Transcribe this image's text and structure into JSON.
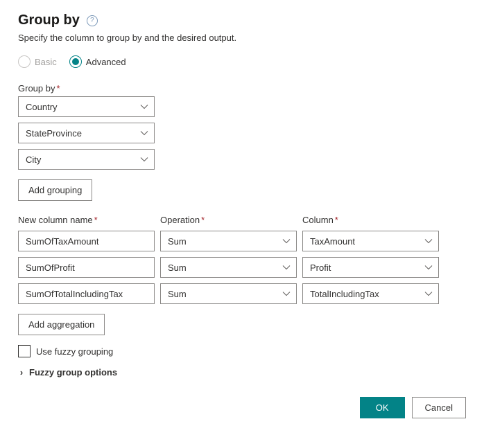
{
  "dialog": {
    "title": "Group by",
    "subtitle": "Specify the column to group by and the desired output."
  },
  "mode": {
    "basic_label": "Basic",
    "advanced_label": "Advanced",
    "selected": "Advanced"
  },
  "groupby": {
    "label": "Group by",
    "columns": [
      "Country",
      "StateProvince",
      "City"
    ],
    "add_button": "Add grouping"
  },
  "aggregations": {
    "headers": {
      "name": "New column name",
      "operation": "Operation",
      "column": "Column"
    },
    "rows": [
      {
        "name": "SumOfTaxAmount",
        "operation": "Sum",
        "column": "TaxAmount"
      },
      {
        "name": "SumOfProfit",
        "operation": "Sum",
        "column": "Profit"
      },
      {
        "name": "SumOfTotalIncludingTax",
        "operation": "Sum",
        "column": "TotalIncludingTax"
      }
    ],
    "add_button": "Add aggregation"
  },
  "fuzzy": {
    "checkbox_label": "Use fuzzy grouping",
    "checked": false,
    "options_label": "Fuzzy group options"
  },
  "footer": {
    "ok_label": "OK",
    "cancel_label": "Cancel"
  }
}
